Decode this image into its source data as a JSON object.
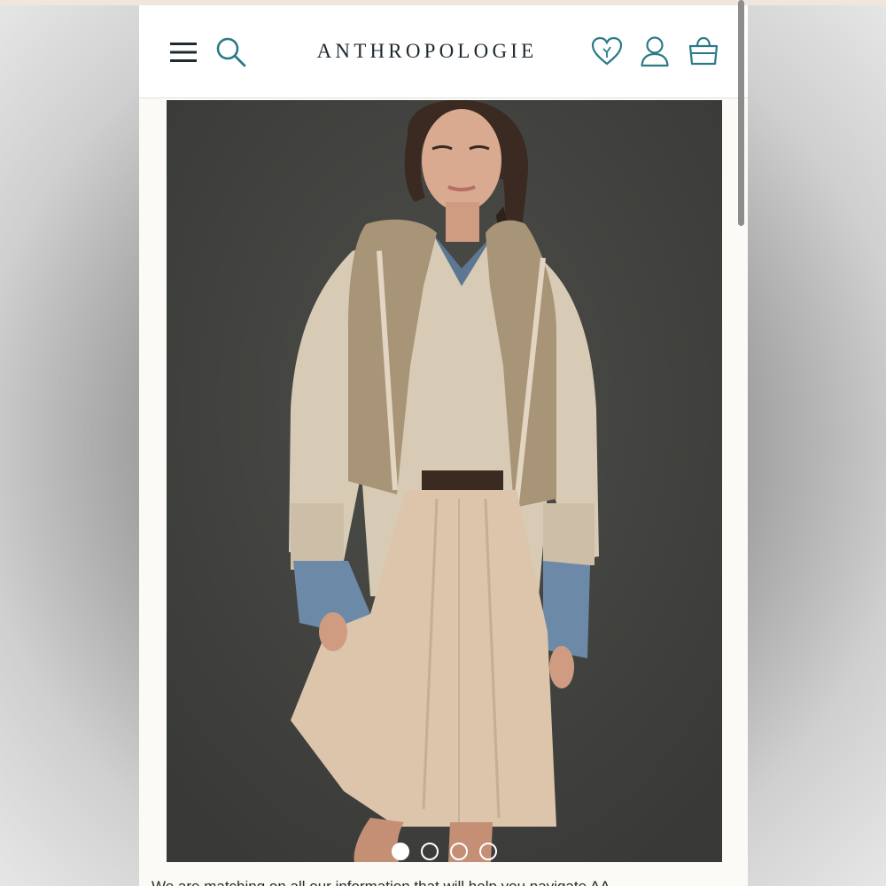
{
  "header": {
    "logo": "ANTHROPOLOGIE",
    "menu_icon": "hamburger-menu-icon",
    "search_icon": "search-icon",
    "wishlist_icon": "heart-icon",
    "account_icon": "user-icon",
    "bag_icon": "shopping-bag-icon"
  },
  "hero": {
    "image_subject": "product-photo",
    "carousel": {
      "slide_count": 4,
      "active_index": 0
    }
  },
  "footer_text": "We are matching on all our information that will help you navigate AA",
  "colors": {
    "accent": "#2a7a86",
    "logo": "#1f2a30",
    "page_bg": "#fcfaf6",
    "hero_bg": "#434441"
  }
}
